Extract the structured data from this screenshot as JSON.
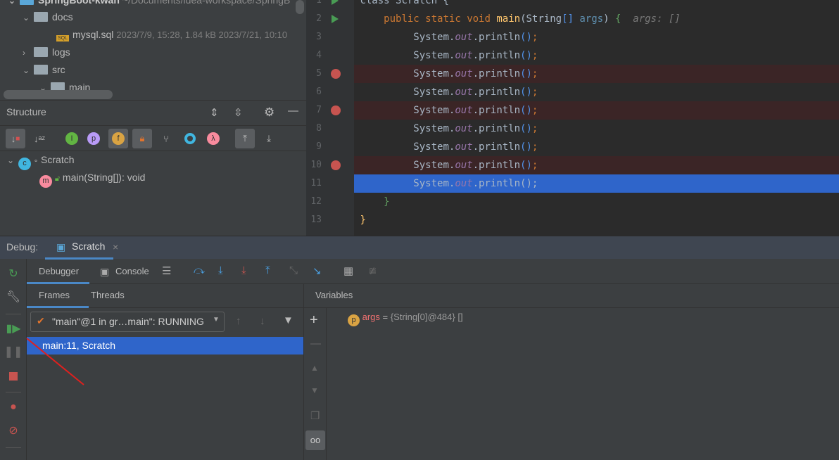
{
  "project": {
    "root": {
      "name": "SpringBoot-kwan",
      "path": "~/Documents/idea-workspace/SpringB"
    },
    "items": [
      {
        "name": "docs",
        "type": "folder",
        "expanded": true
      },
      {
        "name": "mysql.sql",
        "type": "file",
        "meta": "2023/7/9, 15:28, 1.84 kB 2023/7/21, 10:10"
      },
      {
        "name": "logs",
        "type": "folder",
        "expanded": false
      },
      {
        "name": "src",
        "type": "folder",
        "expanded": true
      },
      {
        "name": "main",
        "type": "folder",
        "expanded": true
      }
    ],
    "file_badge": "SQL"
  },
  "structure": {
    "title": "Structure",
    "tree": [
      {
        "name": "Scratch",
        "icon": "class-icon"
      },
      {
        "name": "main(String[]): void",
        "icon": "method-icon"
      }
    ]
  },
  "editor": {
    "lines": [
      {
        "n": "1",
        "code": "class Scratch {"
      },
      {
        "n": "2",
        "code": "main"
      },
      {
        "n": "3",
        "code": "println"
      },
      {
        "n": "4",
        "code": "println"
      },
      {
        "n": "5",
        "code": "println",
        "bp": true
      },
      {
        "n": "6",
        "code": "println"
      },
      {
        "n": "7",
        "code": "println",
        "bp": true
      },
      {
        "n": "8",
        "code": "println"
      },
      {
        "n": "9",
        "code": "println"
      },
      {
        "n": "10",
        "code": "println",
        "bp": true
      },
      {
        "n": "11",
        "code": "println",
        "current": true
      },
      {
        "n": "12",
        "code": "}"
      },
      {
        "n": "13",
        "code": "}"
      }
    ],
    "tokens": {
      "public": "public",
      "static": "static",
      "void": "void",
      "main": "main",
      "string": "String",
      "arr": "[]",
      "args": "args",
      "hint": "args: []",
      "system": "System.",
      "out": "out",
      "println": ".println",
      "parens": "()",
      "semi": ";"
    }
  },
  "debug": {
    "label": "Debug:",
    "session_tab": "Scratch",
    "tabs": {
      "debugger": "Debugger",
      "console": "Console"
    },
    "frames_tabs": {
      "frames": "Frames",
      "threads": "Threads"
    },
    "thread_select": "\"main\"@1 in gr…main\": RUNNING",
    "frames": [
      "main:11, Scratch"
    ],
    "variables_title": "Variables",
    "variables": [
      {
        "name": "args",
        "eq": " = ",
        "value": "{String[0]@484} []"
      }
    ]
  },
  "colors": {
    "breakpoint": "#c75450",
    "selection": "#4b6eaf",
    "current_line": "#2f65ca",
    "accent_arrow": "#e0201e"
  }
}
